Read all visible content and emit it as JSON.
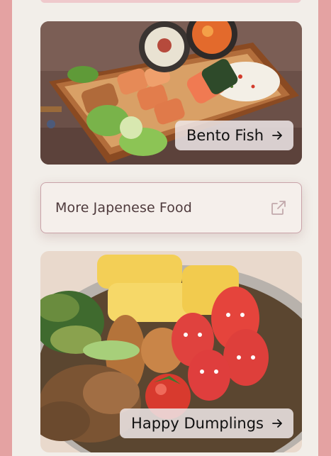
{
  "cards": [
    {
      "title": "Bento Fish",
      "icon": "arrow-right-icon"
    },
    {
      "title": "Happy Dumplings",
      "icon": "arrow-right-icon"
    }
  ],
  "more_link": {
    "label": "More Japenese Food",
    "icon": "external-link-icon"
  },
  "colors": {
    "page_bg": "#e4a2a2",
    "panel_bg": "#f2eee9",
    "link_border": "#c9a2a8",
    "link_text": "#4e3a3c"
  }
}
